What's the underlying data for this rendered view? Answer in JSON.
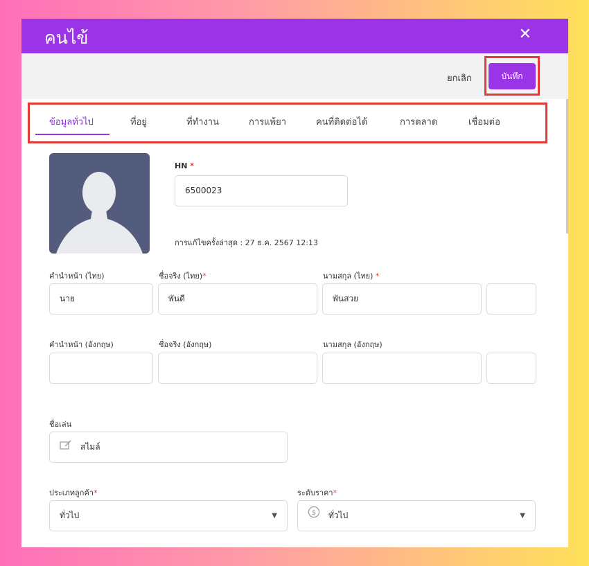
{
  "dialog": {
    "title": "คนไข้",
    "close_label": "✕"
  },
  "actions": {
    "cancel_label": "ยกเลิก",
    "save_label": "บันทึก"
  },
  "tabs": [
    {
      "label": "ข้อมูลทั่วไป",
      "active": true
    },
    {
      "label": "ที่อยู่"
    },
    {
      "label": "ที่ทำงาน"
    },
    {
      "label": "การแพ้ยา"
    },
    {
      "label": "คนที่ติดต่อได้"
    },
    {
      "label": "การตลาด"
    },
    {
      "label": "เชื่อมต่อ"
    }
  ],
  "hn": {
    "label": "HN",
    "required": "*",
    "value": "6500023"
  },
  "last_edit": "การแก้ไขครั้งล่าสุด : 27 ธ.ค. 2567 12:13",
  "thai_name": {
    "prefix_label": "คำนำหน้า (ไทย)",
    "prefix_value": "นาย",
    "first_label": "ชื่อจริง (ไทย)",
    "first_required": "*",
    "first_value": "พันดี",
    "last_label": "นามสกุล (ไทย)",
    "last_required": "*",
    "last_value": "พันสวย",
    "extra_value": ""
  },
  "eng_name": {
    "prefix_label": "คำนำหน้า (อังกฤษ)",
    "prefix_value": "",
    "first_label": "ชื่อจริง (อังกฤษ)",
    "first_value": "",
    "last_label": "นามสกุล (อังกฤษ)",
    "last_value": "",
    "extra_value": ""
  },
  "nickname": {
    "label": "ชื่อเล่น",
    "value": "สไมล์",
    "icon": "edit-icon"
  },
  "customer_type": {
    "label": "ประเภทลูกค้า",
    "required": "*",
    "value": "ทั่วไป"
  },
  "price_level": {
    "label": "ระดับราคา",
    "required": "*",
    "value": "ทั่วไป",
    "icon": "dollar-icon"
  },
  "colors": {
    "brand": "#9b33e6",
    "highlight": "#e53935",
    "avatar_bg": "#545c7d"
  }
}
